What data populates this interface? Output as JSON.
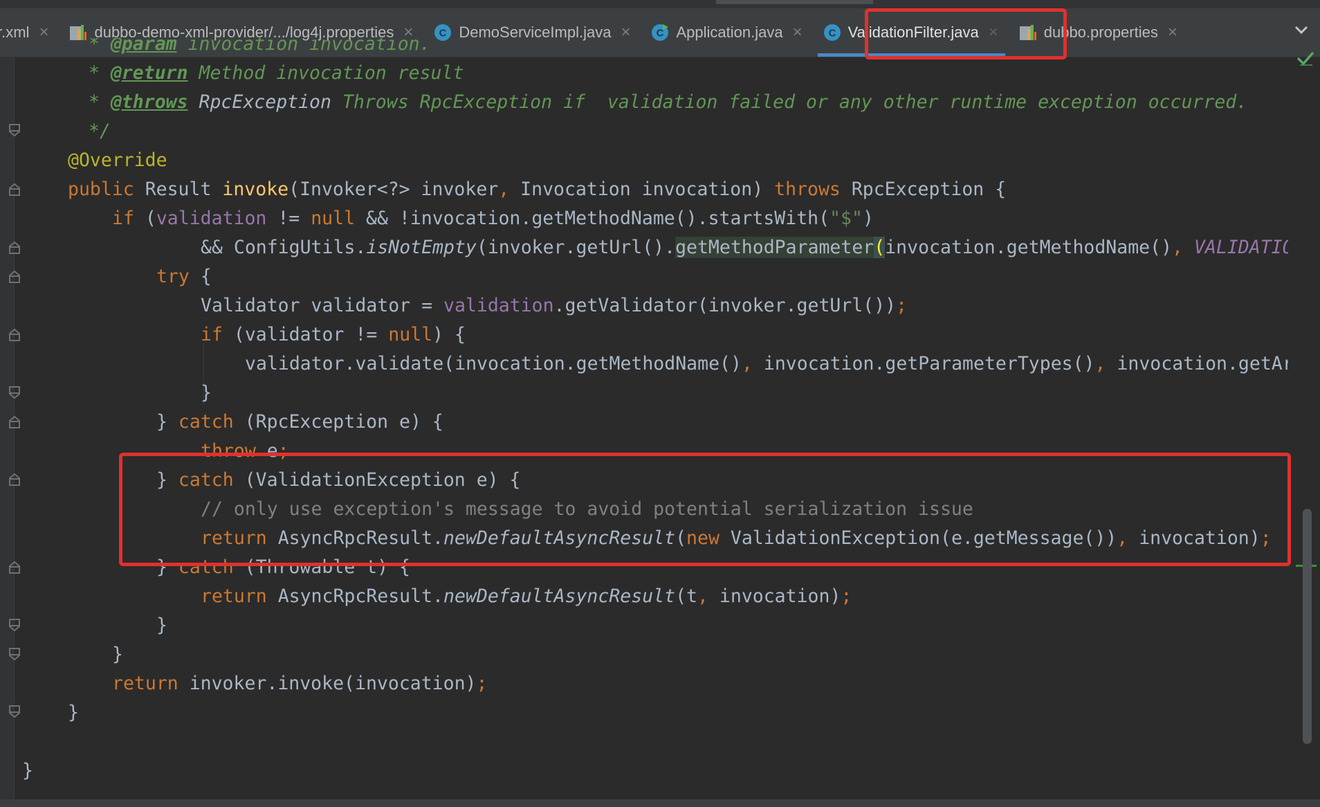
{
  "tabs": [
    {
      "label": "r.xml",
      "icon": "xml-file-icon"
    },
    {
      "label": "dubbo-demo-xml-provider/.../log4j.properties",
      "icon": "properties-file-icon"
    },
    {
      "label": "DemoServiceImpl.java",
      "icon": "java-class-icon"
    },
    {
      "label": "Application.java",
      "icon": "java-class-run-icon"
    },
    {
      "label": "ValidationFilter.java",
      "icon": "java-class-icon",
      "active": true
    },
    {
      "label": "dubbo.properties",
      "icon": "properties-file-icon"
    }
  ],
  "tab_close_glyph": "×",
  "colors": {
    "keyword": "#cc7832",
    "annotation": "#bbb529",
    "method_decl": "#ffc66d",
    "field": "#9876aa",
    "string": "#6a8759",
    "doc_comment": "#629755",
    "comment": "#808080",
    "default_text": "#a9b7c6",
    "highlight_box": "#e0312e",
    "active_tab_underline": "#4a88c7"
  },
  "code": {
    "l0": {
      "a": " * ",
      "tag": "@param",
      "b": " invocation invocation."
    },
    "l1": {
      "a": " * ",
      "tag": "@return",
      "b": " Method invocation result"
    },
    "l2": {
      "a": " * ",
      "tag": "@throws",
      "type": " RpcException",
      "b": " Throws RpcException if  validation failed or any other runtime exception occurred."
    },
    "l3": {
      "a": " */"
    },
    "l4": {
      "ann": "@Override"
    },
    "l5": {
      "kw1": "public",
      "t1": " Result ",
      "fn": "invoke",
      "t2": "(Invoker<?> invoker",
      "sep": ",",
      "t3": " Invocation invocation) ",
      "kw2": "throws",
      "t4": " RpcException {"
    },
    "l6": {
      "kw1": "if",
      "t1": " (",
      "fld": "validation",
      "t2": " != ",
      "kw2": "null",
      "t3": " && !invocation.getMethodName().startsWith(",
      "str": "\"$\"",
      "t4": ")"
    },
    "l7": {
      "t1": "&& ConfigUtils.",
      "sta": "isNotEmpty",
      "t2": "(invoker.getUrl().",
      "hl": "getMethodParameter",
      "brk": "(",
      "t3": "invocation.getMethodName()",
      "sep": ",",
      "const": " VALIDATION_"
    },
    "l8": {
      "kw": "try",
      "t": " {"
    },
    "l9": {
      "t1": "Validator validator = ",
      "fld": "validation",
      "t2": ".getValidator(invoker.getUrl())",
      "sep": ";"
    },
    "l10": {
      "kw1": "if",
      "t1": " (validator != ",
      "kw2": "null",
      "t2": ") {"
    },
    "l11": {
      "t1": "validator.validate(invocation.getMethodName()",
      "s1": ",",
      "t2": " invocation.getParameterTypes()",
      "s2": ",",
      "t3": " invocation.getArgu"
    },
    "l12": {
      "t": "}"
    },
    "l13": {
      "t1": "} ",
      "kw": "catch",
      "t2": " (RpcException e) {"
    },
    "l14": {
      "kw": "throw",
      "t": " e",
      "sep": ";"
    },
    "l15": {
      "t1": "} ",
      "kw": "catch",
      "t2": " (ValidationException e) {"
    },
    "l16": {
      "cmt": "// only use exception's message to avoid potential serialization issue"
    },
    "l17": {
      "kw1": "return",
      "t1": " AsyncRpcResult.",
      "sta": "newDefaultAsyncResult",
      "t2": "(",
      "kw2": "new",
      "t3": " ValidationException(e.getMessage())",
      "s1": ",",
      "t4": " invocation)",
      "s2": ";"
    },
    "l18": {
      "t1": "} ",
      "kw": "catch",
      "t2": " (Throwable t) {"
    },
    "l19": {
      "kw": "return",
      "t1": " AsyncRpcResult.",
      "sta": "newDefaultAsyncResult",
      "t2": "(t",
      "s1": ",",
      "t3": " invocation)",
      "s2": ";"
    },
    "l20": {
      "t": "}"
    },
    "l21": {
      "t": "}"
    },
    "l22": {
      "kw": "return",
      "t": " invoker.invoke(invocation)",
      "sep": ";"
    },
    "l23": {
      "t": "}"
    },
    "l24": {
      "t": "}"
    }
  }
}
